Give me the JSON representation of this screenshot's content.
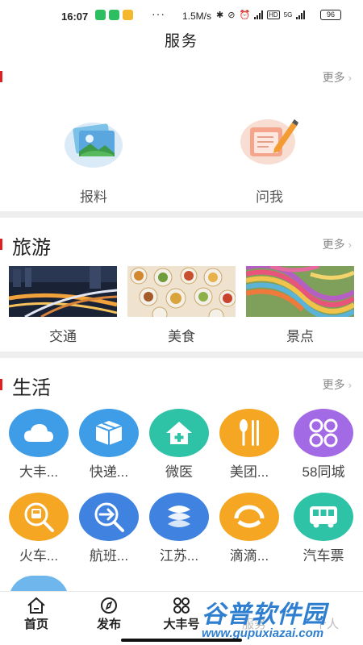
{
  "status_bar": {
    "time": "16:07",
    "speed": "1.5M/s",
    "hd": "HD",
    "net": "5G",
    "battery": "96"
  },
  "page": {
    "title": "服务"
  },
  "top_section": {
    "more": "更多",
    "items": [
      {
        "label": "报料",
        "icon": "photo-report-icon"
      },
      {
        "label": "问我",
        "icon": "ask-notepad-icon"
      }
    ]
  },
  "travel": {
    "title": "旅游",
    "more": "更多",
    "items": [
      {
        "label": "交通",
        "image": "city-night-traffic"
      },
      {
        "label": "美食",
        "image": "food-table"
      },
      {
        "label": "景点",
        "image": "colorful-terraces"
      }
    ]
  },
  "life": {
    "title": "生活",
    "more": "更多",
    "items": [
      {
        "label": "大丰...",
        "icon": "cloud-icon",
        "color": "#3f9de8"
      },
      {
        "label": "快递...",
        "icon": "box-icon",
        "color": "#3f9de8"
      },
      {
        "label": "微医",
        "icon": "medical-home-icon",
        "color": "#2ec2a6"
      },
      {
        "label": "美团...",
        "icon": "spoon-fork-icon",
        "color": "#f5a623"
      },
      {
        "label": "58同城",
        "icon": "grid-circles-icon",
        "color": "#a36ae6"
      },
      {
        "label": "火车...",
        "icon": "train-search-icon",
        "color": "#f5a623"
      },
      {
        "label": "航班...",
        "icon": "flight-search-icon",
        "color": "#3f82e0"
      },
      {
        "label": "江苏...",
        "icon": "mobile-logo-icon",
        "color": "#3f82e0"
      },
      {
        "label": "滴滴...",
        "icon": "didi-icon",
        "color": "#f5a623"
      },
      {
        "label": "汽车票",
        "icon": "bus-icon",
        "color": "#2ec2a6"
      }
    ]
  },
  "tabbar": {
    "tabs": [
      {
        "label": "首页",
        "icon": "home-icon"
      },
      {
        "label": "发布",
        "icon": "compass-icon"
      },
      {
        "label": "大丰号",
        "icon": "apps-icon"
      },
      {
        "label": "服务",
        "icon": "service-icon"
      },
      {
        "label": "个人",
        "icon": "person-icon"
      }
    ]
  },
  "watermark": {
    "text": "谷普软件园",
    "url": "www.gupuxiazai.com"
  }
}
